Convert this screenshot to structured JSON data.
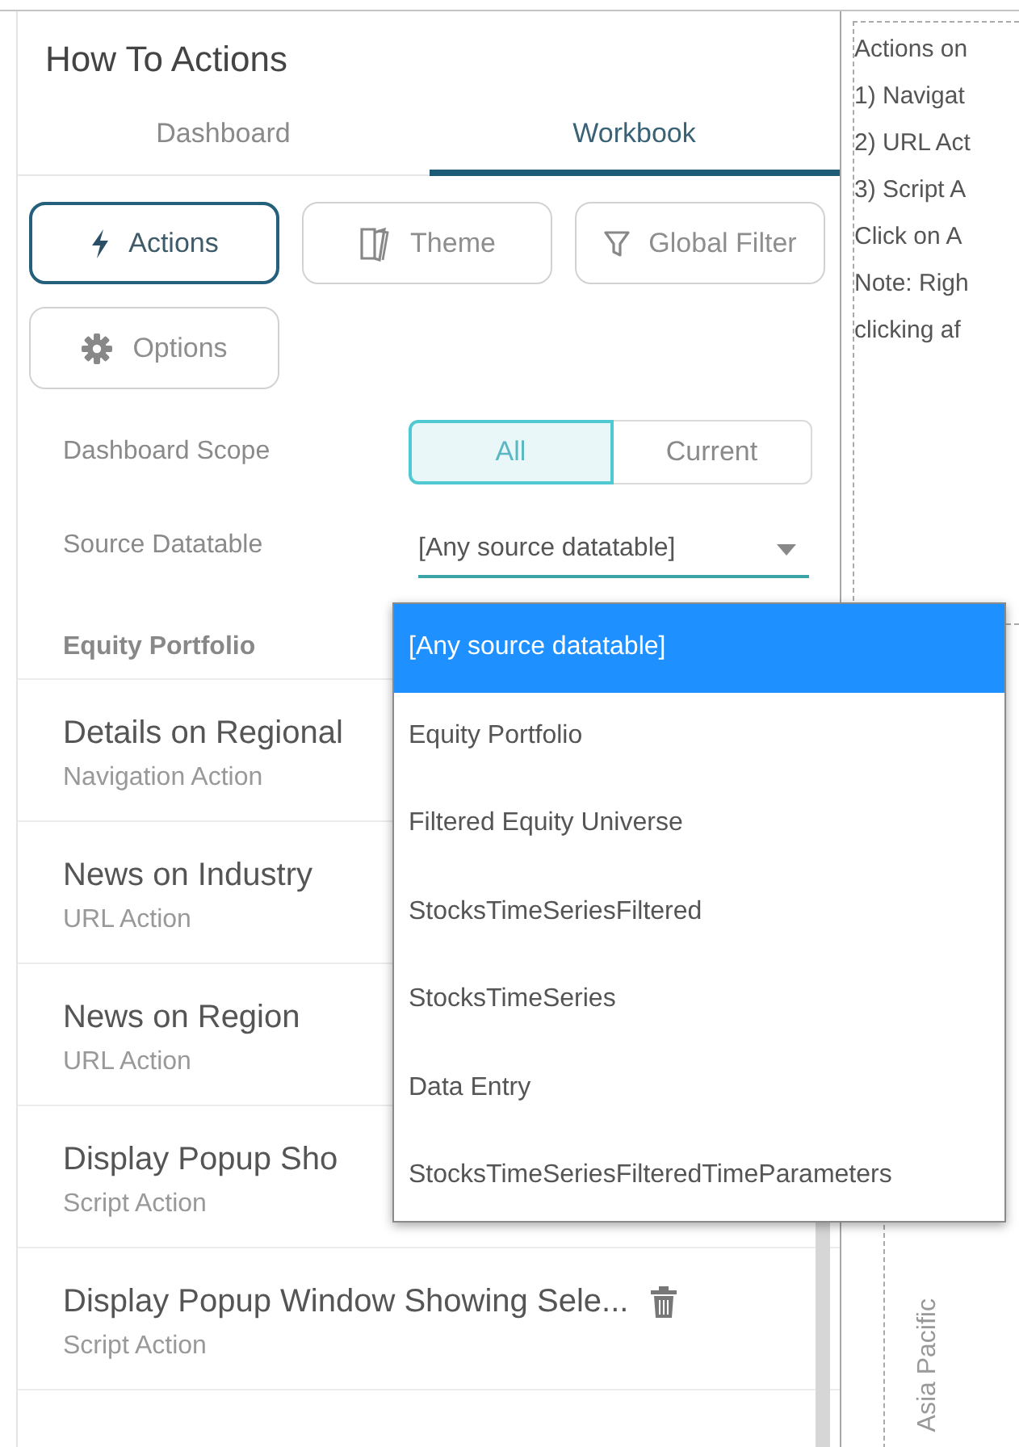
{
  "panel": {
    "title": "How To Actions"
  },
  "tabs": [
    {
      "label": "Dashboard",
      "selected": false
    },
    {
      "label": "Workbook",
      "selected": true
    }
  ],
  "toolbar": [
    {
      "label": "Actions",
      "selected": true
    },
    {
      "label": "Theme",
      "selected": false
    },
    {
      "label": "Global Filter",
      "selected": false
    },
    {
      "label": "Options",
      "selected": false
    }
  ],
  "scope": {
    "label": "Dashboard Scope",
    "options": [
      {
        "label": "All",
        "selected": true
      },
      {
        "label": "Current",
        "selected": false
      }
    ]
  },
  "source": {
    "label": "Source Datatable",
    "value": "[Any source datatable]"
  },
  "group": {
    "header": "Equity Portfolio"
  },
  "actions": [
    {
      "title": "Details on Regional",
      "type": "Navigation Action",
      "hovered": false
    },
    {
      "title": "News on Industry",
      "type": "URL Action",
      "hovered": false
    },
    {
      "title": "News on Region",
      "type": "URL Action",
      "hovered": false
    },
    {
      "title": "Display Popup Sho",
      "type": "Script Action",
      "hovered": false
    },
    {
      "title": "Display Popup Window Showing Sele...",
      "type": "Script Action",
      "hovered": true
    }
  ],
  "dropdown": {
    "options": [
      {
        "label": "[Any source datatable]",
        "selected": true
      },
      {
        "label": "Equity Portfolio",
        "selected": false
      },
      {
        "label": "Filtered Equity Universe",
        "selected": false
      },
      {
        "label": "StocksTimeSeriesFiltered",
        "selected": false
      },
      {
        "label": "StocksTimeSeries",
        "selected": false
      },
      {
        "label": "Data Entry",
        "selected": false
      },
      {
        "label": "StocksTimeSeriesFilteredTimeParameters",
        "selected": false
      }
    ]
  },
  "notes": {
    "lines": [
      "Actions on",
      "1) Navigat",
      "2) URL Act",
      "3) Script A",
      "Click on A",
      "Note: Righ",
      "clicking af"
    ]
  },
  "chart": {
    "axis_label": "Asia Pacific"
  }
}
